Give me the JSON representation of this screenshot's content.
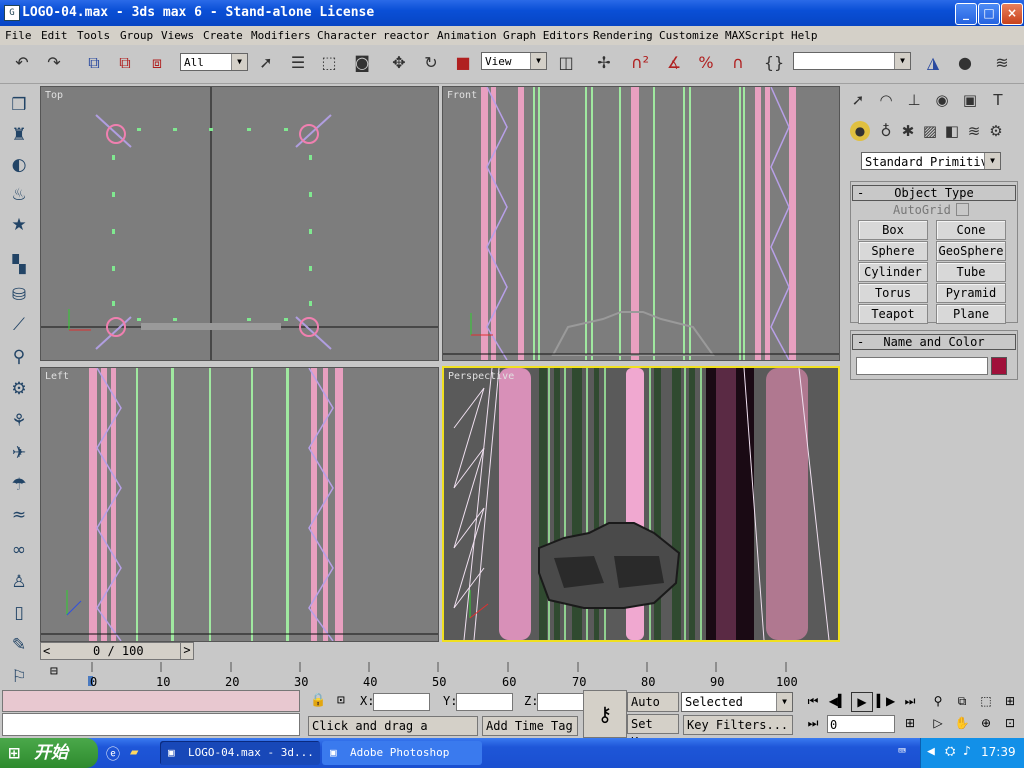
{
  "window": {
    "title": "LOGO-04.max - 3ds max 6 - Stand-alone License",
    "app_icon": "3ds-max-icon",
    "controls": [
      "_",
      "□",
      "×"
    ]
  },
  "menu": [
    "File",
    "Edit",
    "Tools",
    "Group",
    "Views",
    "Create",
    "Modifiers",
    "Character",
    "reactor",
    "Animation",
    "Graph Editors",
    "Rendering",
    "Customize",
    "MAXScript",
    "Help"
  ],
  "toolbar": {
    "selection_filter": "All",
    "ref_coord": "View",
    "named_selection": "",
    "icons": [
      "undo-icon",
      "redo-icon",
      "select-link-icon",
      "unlink-icon",
      "bind-space-warp-icon",
      "select-object-icon",
      "select-by-name-icon",
      "rectangular-region-icon",
      "window-crossing-icon",
      "move-icon",
      "rotate-icon",
      "scale-icon",
      "use-pivot-icon",
      "manipulate-icon",
      "snap-3d-icon",
      "angle-snap-icon",
      "percent-snap-icon",
      "spinner-snap-icon",
      "edit-named-sel-icon",
      "mirror-icon",
      "align-icon",
      "layers-icon"
    ]
  },
  "viewports": {
    "top": "Top",
    "front": "Front",
    "left": "Left",
    "perspective": "Perspective"
  },
  "command_panel": {
    "dropdown": "Standard Primitiv",
    "object_type": {
      "title": "Object Type",
      "autogrid": "AutoGrid",
      "buttons": [
        "Box",
        "Cone",
        "Sphere",
        "GeoSphere",
        "Cylinder",
        "Tube",
        "Torus",
        "Pyramid",
        "Teapot",
        "Plane"
      ]
    },
    "name_color": {
      "title": "Name and Color",
      "name_value": "",
      "color": "#a0103a"
    }
  },
  "timeline": {
    "frame_display": "0 / 100",
    "ticks": [
      "0",
      "10",
      "20",
      "30",
      "40",
      "50",
      "60",
      "70",
      "80",
      "90",
      "100"
    ]
  },
  "status": {
    "x_label": "X:",
    "y_label": "Y:",
    "z_label": "Z:",
    "prompt": "Click and drag a region",
    "add_time_tag": "Add Time Tag",
    "auto_key": "Auto Key",
    "set_key": "Set Key",
    "selected": "Selected",
    "key_filters": "Key Filters...",
    "frame": "0"
  },
  "taskbar": {
    "start": "开始",
    "tasks": [
      "LOGO-04.max - 3d...",
      "Adobe Photoshop"
    ],
    "clock": "17:39"
  },
  "colors": {
    "accent_yellow": "#f0e020",
    "pink_geometry": "#e8a0c0",
    "green_geometry": "#a0e8a0"
  }
}
